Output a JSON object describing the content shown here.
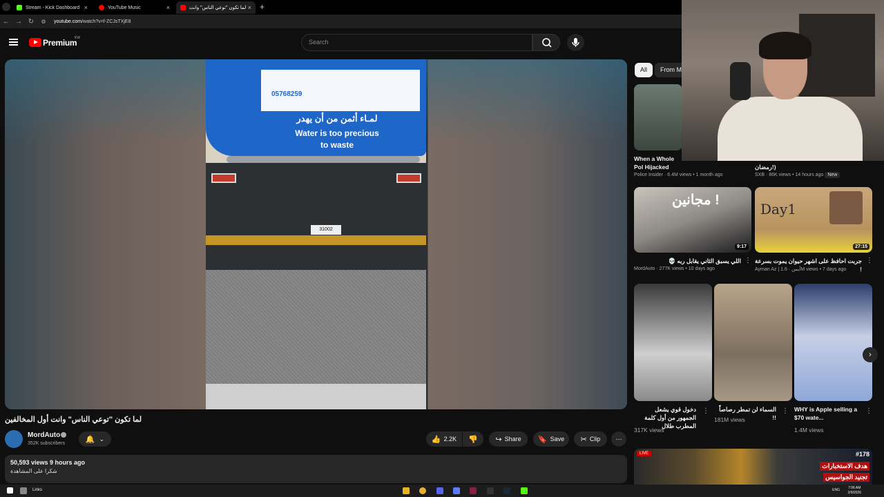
{
  "browser": {
    "tabs": [
      {
        "label": "Stream - Kick Dashboard",
        "active": false
      },
      {
        "label": "YouTube Music",
        "active": false
      },
      {
        "label": "لما تكون \"توعي الناس\" وانت",
        "active": true
      }
    ],
    "url_host": "youtube.com",
    "url_path": "/watch?v=f-ZCJsTXjE8"
  },
  "header": {
    "brand": "Premium",
    "country": "KW",
    "search_placeholder": "Search"
  },
  "video": {
    "tank_text_1": "لمـاء أثمن من أن يهدر",
    "tank_text_2": "Water is too precious",
    "tank_text_3": "to waste",
    "tank_phone": "05768259",
    "plate": "31002"
  },
  "watch": {
    "title": "لما تكون \"توعي الناس\" وانت أول المخالفين",
    "channel": "MordAuto",
    "subscribers": "352K subscribers",
    "likes": "2.2K",
    "share": "Share",
    "save": "Save",
    "clip": "Clip",
    "views_line": "50,593 views  9 hours ago",
    "description": "شكرا على المشاهدة"
  },
  "chips": [
    "All",
    "From M"
  ],
  "sidebar": {
    "row1": [
      {
        "title": "When a Whole Pol Hijacked",
        "channel": "Police Insider",
        "meta": "6.4M views • 1 month ago"
      },
      {
        "title": "رمضان!)",
        "channel": "SXB",
        "meta": "86K views • 14 hours ago",
        "badge": "New"
      }
    ],
    "row2": [
      {
        "title": "💀 اللي يسبق الثاني يقابل ربه",
        "channel": "MordAuto",
        "meta": "277K views • 10 days ago",
        "duration": "9:17",
        "overlay": "مجانين !"
      },
      {
        "title": "جربت احافظ على اشهر حيوان يموت بسرعة !",
        "channel": "Ayman Az | أيمن",
        "meta": "1.6M views • 7 days ago",
        "duration": "27:15",
        "overlay": "Day1"
      }
    ],
    "shorts": [
      {
        "title": "دخول قوي يشعل الجمهور من أول كلمة المطرب طلال",
        "views": "317K views"
      },
      {
        "title": "السماء لن تمطر رصاصاً !!",
        "views": "181M views"
      },
      {
        "title": "WHY is Apple selling a $70 wate...",
        "views": "1.4M views"
      }
    ],
    "bottom": {
      "live": "LIVE",
      "label": "#178",
      "arabic_1": "هدف الاستخبارات",
      "arabic_2": "تجنيد الجواسيس"
    }
  },
  "taskbar": {
    "links": "Links",
    "lang": "ENG",
    "time": "7:06 AM",
    "date": "2/9/2026"
  }
}
